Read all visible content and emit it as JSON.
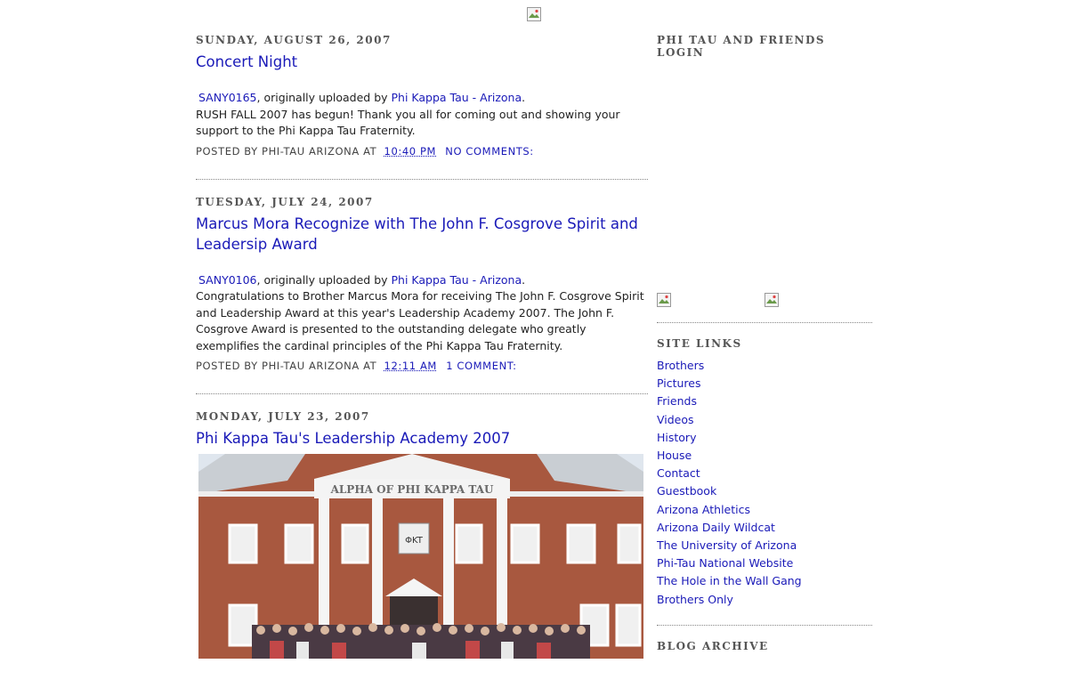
{
  "posts": [
    {
      "date": "SUNDAY, AUGUST 26, 2007",
      "title": "Concert Night",
      "photo_link": "SANY0165",
      "uploaded_text": ", originally uploaded by ",
      "uploader": "Phi Kappa Tau - Arizona",
      "period": ".",
      "body": "RUSH FALL 2007 has begun! Thank you all for coming out and showing your support to the Phi Kappa Tau Fraternity.",
      "posted_by": "POSTED BY PHI-TAU ARIZONA AT",
      "time": "10:40 PM",
      "comments": "NO COMMENTS:"
    },
    {
      "date": "TUESDAY, JULY 24, 2007",
      "title": "Marcus Mora Recognize with The John F. Cosgrove Spirit and Leadersip Award",
      "photo_link": "SANY0106",
      "uploaded_text": ", originally uploaded by ",
      "uploader": "Phi Kappa Tau - Arizona",
      "period": ".",
      "body": "Congratulations to Brother Marcus Mora for receiving The John F. Cosgrove Spirit and Leadership Award at this year's Leadership Academy 2007. The John F. Cosgrove Award is presented to the outstanding delegate who greatly exemplifies the cardinal principles of the Phi Kappa Tau Fraternity.",
      "posted_by": "POSTED BY PHI-TAU ARIZONA AT",
      "time": "12:11 AM",
      "comments": "1 COMMENT:"
    },
    {
      "date": "MONDAY, JULY 23, 2007",
      "title": "Phi Kappa Tau's Leadership Academy 2007",
      "photo_caption": "ALPHA OF PHI KAPPA TAU",
      "photo_letters": "ΦKT"
    }
  ],
  "sidebar": {
    "login_title": "PHI TAU AND FRIENDS LOGIN",
    "links_title": "SITE LINKS",
    "links": [
      "Brothers",
      "Pictures",
      "Friends",
      "Videos",
      "History",
      "House",
      "Contact",
      "Guestbook",
      "Arizona Athletics",
      "Arizona Daily Wildcat",
      "The University of Arizona",
      "Phi-Tau National Website",
      "The Hole in the Wall Gang",
      "Brothers Only"
    ],
    "archive_title": "BLOG ARCHIVE"
  },
  "colors": {
    "link": "#1a1ab8",
    "text": "#222222",
    "muted": "#555555"
  }
}
